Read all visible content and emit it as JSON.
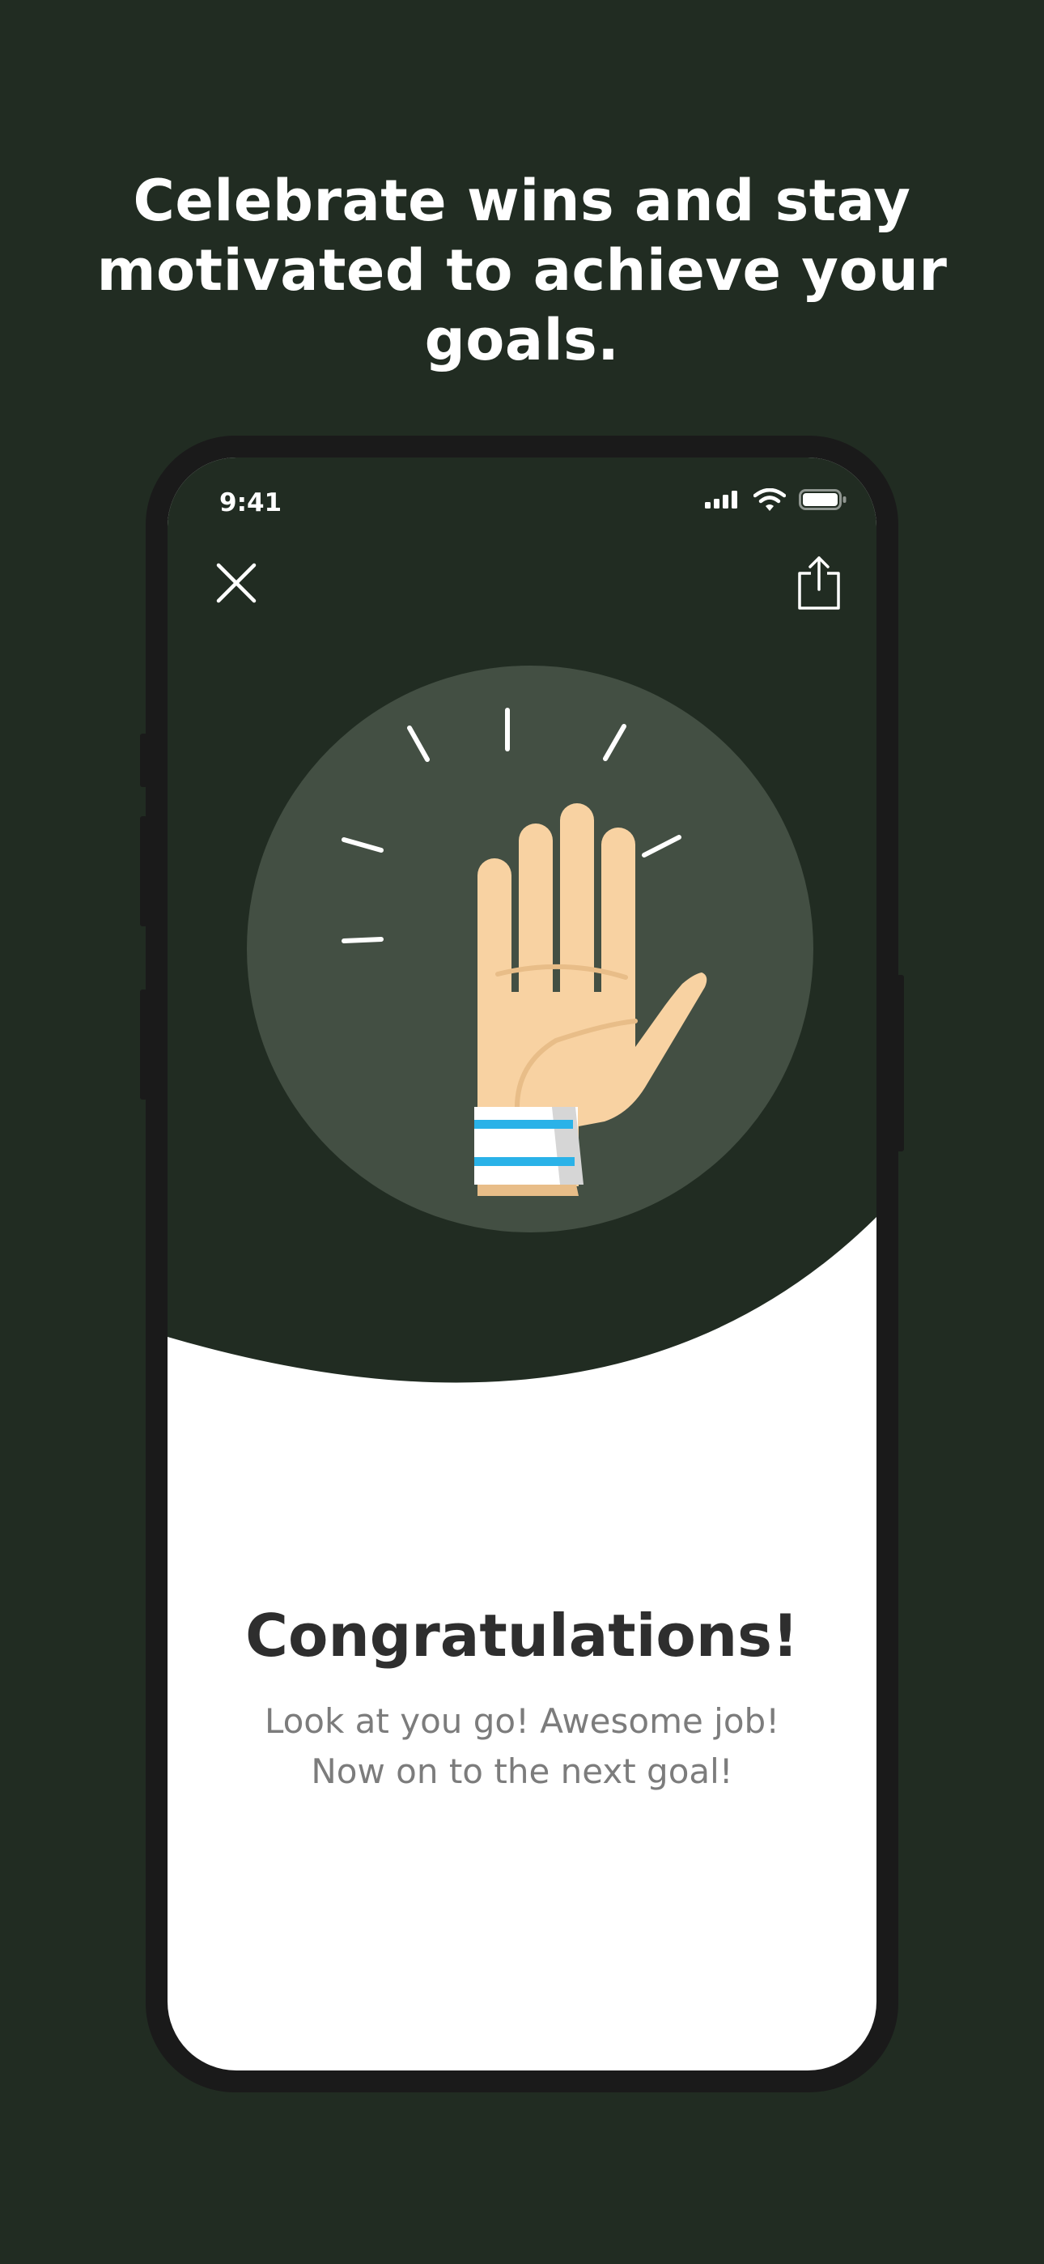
{
  "headline": {
    "line1": "Celebrate wins and stay",
    "line2": "motivated to achieve your",
    "line3": "goals."
  },
  "status_bar": {
    "time": "9:41",
    "icons": [
      "cellular-signal-icon",
      "wifi-icon",
      "battery-icon"
    ]
  },
  "toolbar": {
    "close_icon": "close-icon",
    "share_icon": "share-icon"
  },
  "illustration": {
    "subject": "raised-hand-with-wristband"
  },
  "celebration": {
    "title": "Congratulations!",
    "message_line1": "Look at you go! Awesome job!",
    "message_line2": "Now on to the next goal!"
  },
  "colors": {
    "background": "#212c22",
    "illustration_circle": "#434f43",
    "skin": "#f8d2a2",
    "wristband_stripe": "#2ab2e8",
    "title_text": "#2e2e2e",
    "message_text": "#7c7c7c"
  }
}
